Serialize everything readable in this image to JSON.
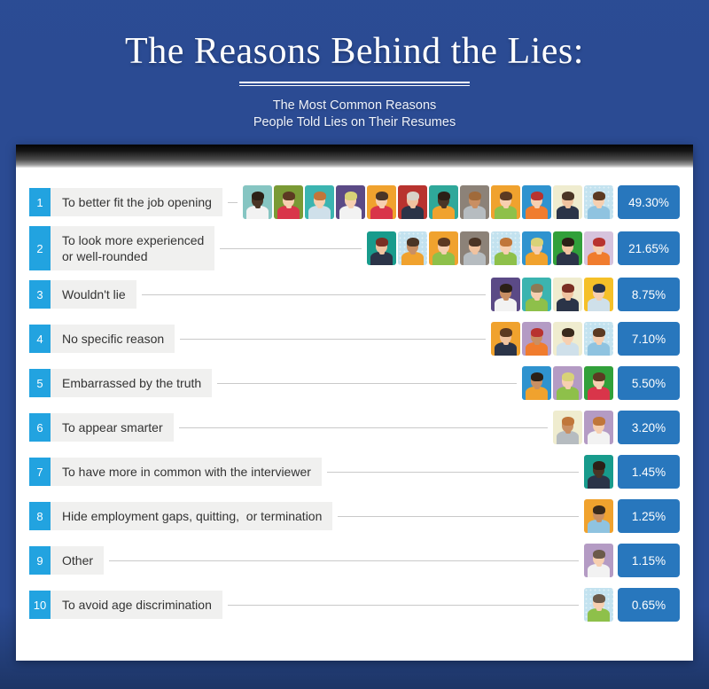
{
  "header": {
    "title": "The Reasons Behind the Lies:",
    "subtitle_line1": "The Most Common Reasons",
    "subtitle_line2": "People Told Lies on Their Resumes"
  },
  "colors": {
    "background": "#2b4b93",
    "card": "#ffffff",
    "rank_badge": "#22a3e0",
    "label_chip": "#f0f0ef",
    "percent_badge": "#2877bd",
    "connector": "#c9c9c9"
  },
  "chart_data": {
    "type": "bar",
    "title": "The Reasons Behind the Lies:",
    "subtitle": "The Most Common Reasons People Told Lies on Their Resumes",
    "xlabel": "",
    "ylabel": "",
    "unit": "%",
    "note": "Pictorial bar chart: each avatar icon represents one unit of the count; bars are right-aligned.",
    "categories": [
      "To better fit the job opening",
      "To look more experienced or well-rounded",
      "Wouldn't lie",
      "No specific reason",
      "Embarrassed by the truth",
      "To appear smarter",
      "To have more in common with the interviewer",
      "Hide employment gaps, quitting,  or termination",
      "Other",
      "To avoid age discrimination"
    ],
    "values": [
      49.3,
      21.65,
      8.75,
      7.1,
      5.5,
      3.2,
      1.45,
      1.25,
      1.15,
      0.65
    ],
    "value_labels": [
      "49.30%",
      "21.65%",
      "8.75%",
      "7.10%",
      "5.50%",
      "3.20%",
      "1.45%",
      "1.25%",
      "1.15%",
      "0.65%"
    ],
    "icon_counts": [
      13,
      8,
      4,
      4,
      3,
      2,
      1,
      1,
      1,
      1
    ],
    "ranks": [
      1,
      2,
      3,
      4,
      5,
      6,
      7,
      8,
      9,
      10
    ]
  },
  "rows": [
    {
      "rank": "1",
      "label": "To better fit the job opening",
      "percent": "49.30%",
      "avatars": [
        {
          "bg": "#86c5c2",
          "hair": "#2b2016",
          "skin": "#4a3526",
          "shirt": "#f2f2f2",
          "dots": false
        },
        {
          "bg": "#7a9a35",
          "hair": "#5c3a22",
          "skin": "#f6cfb0",
          "shirt": "#d9354a",
          "dots": false
        },
        {
          "bg": "#3bb4b0",
          "hair": "#c0763a",
          "skin": "#f6cfb0",
          "shirt": "#cfe0ea",
          "dots": false
        },
        {
          "bg": "#5b4a86",
          "hair": "#d8d277",
          "skin": "#f6cfb0",
          "shirt": "#f2f2f2",
          "dots": false
        },
        {
          "bg": "#f0a22e",
          "hair": "#4a3526",
          "skin": "#f6cfb0",
          "shirt": "#d9354a",
          "dots": false
        },
        {
          "bg": "#b8332f",
          "hair": "#d8d2c8",
          "skin": "#f0c3a0",
          "shirt": "#2b3448",
          "dots": false
        },
        {
          "bg": "#2fa89a",
          "hair": "#2b2016",
          "skin": "#4a3526",
          "shirt": "#f0a22e",
          "dots": false
        },
        {
          "bg": "#8c8278",
          "hair": "#a06a3a",
          "skin": "#c98f63",
          "shirt": "#b6bcc0",
          "dots": false
        },
        {
          "bg": "#f0a22e",
          "hair": "#5c3a22",
          "skin": "#f6cfb0",
          "shirt": "#8ec04a",
          "dots": false
        },
        {
          "bg": "#2f93cf",
          "hair": "#b8332f",
          "skin": "#f6cfb0",
          "shirt": "#f07c2e",
          "dots": false
        },
        {
          "bg": "#efeccf",
          "hair": "#4a3526",
          "skin": "#f0c3a0",
          "shirt": "#2b3448",
          "dots": false
        },
        {
          "bg": "#c3e2ef",
          "hair": "#5c3a22",
          "skin": "#f6cfb0",
          "shirt": "#8fc3e0",
          "dots": true
        }
      ]
    },
    {
      "rank": "2",
      "label": "To look more experienced\nor well-rounded",
      "percent": "21.65%",
      "avatars": [
        {
          "bg": "#189b8c",
          "hair": "#7a2f24",
          "skin": "#f0c3a0",
          "shirt": "#2b3448",
          "dots": false
        },
        {
          "bg": "#c3e2ef",
          "hair": "#4a3526",
          "skin": "#c98f63",
          "shirt": "#f0a22e",
          "dots": true
        },
        {
          "bg": "#f0a22e",
          "hair": "#5c3a22",
          "skin": "#f6cfb0",
          "shirt": "#8ec04a",
          "dots": false
        },
        {
          "bg": "#8c8278",
          "hair": "#4a3526",
          "skin": "#f0c3a0",
          "shirt": "#b6bcc0",
          "dots": false
        },
        {
          "bg": "#c3e2ef",
          "hair": "#c0763a",
          "skin": "#f6cfb0",
          "shirt": "#8ec04a",
          "dots": true
        },
        {
          "bg": "#2f93cf",
          "hair": "#d8d277",
          "skin": "#f6cfb0",
          "shirt": "#f0a22e",
          "dots": false
        },
        {
          "bg": "#31a03a",
          "hair": "#2b2016",
          "skin": "#f0c3a0",
          "shirt": "#2b3448",
          "dots": false
        },
        {
          "bg": "#d6c3dd",
          "hair": "#b8332f",
          "skin": "#f6cfb0",
          "shirt": "#f07c2e",
          "dots": false
        }
      ]
    },
    {
      "rank": "3",
      "label": "Wouldn't lie",
      "percent": "8.75%",
      "avatars": [
        {
          "bg": "#5b4a86",
          "hair": "#2b2016",
          "skin": "#c98f63",
          "shirt": "#f2f2f2",
          "dots": false
        },
        {
          "bg": "#3bb4b0",
          "hair": "#8c7a56",
          "skin": "#f6cfb0",
          "shirt": "#8ec04a",
          "dots": false
        },
        {
          "bg": "#efeccf",
          "hair": "#7a2f24",
          "skin": "#f0c3a0",
          "shirt": "#2b3448",
          "dots": false
        },
        {
          "bg": "#f5c028",
          "hair": "#2b3448",
          "skin": "#f6cfb0",
          "shirt": "#cfe0ea",
          "dots": false
        }
      ]
    },
    {
      "rank": "4",
      "label": "No specific reason",
      "percent": "7.10%",
      "avatars": [
        {
          "bg": "#f0a22e",
          "hair": "#5c3a22",
          "skin": "#f0c3a0",
          "shirt": "#2b3448",
          "dots": false
        },
        {
          "bg": "#b49bc4",
          "hair": "#b8332f",
          "skin": "#c98f63",
          "shirt": "#f07c2e",
          "dots": false
        },
        {
          "bg": "#efeccf",
          "hair": "#3a2a1c",
          "skin": "#f6cfb0",
          "shirt": "#cfe0ea",
          "dots": false
        },
        {
          "bg": "#c3e2ef",
          "hair": "#5c3a22",
          "skin": "#f6cfb0",
          "shirt": "#8fc3e0",
          "dots": true
        }
      ]
    },
    {
      "rank": "5",
      "label": "Embarrassed by the truth",
      "percent": "5.50%",
      "avatars": [
        {
          "bg": "#2f93cf",
          "hair": "#2b2016",
          "skin": "#c98f63",
          "shirt": "#f0a22e",
          "dots": false
        },
        {
          "bg": "#b49bc4",
          "hair": "#d8d277",
          "skin": "#f6cfb0",
          "shirt": "#8ec04a",
          "dots": false
        },
        {
          "bg": "#31a03a",
          "hair": "#5c3a22",
          "skin": "#f6cfb0",
          "shirt": "#d9354a",
          "dots": false
        }
      ]
    },
    {
      "rank": "6",
      "label": "To appear smarter",
      "percent": "3.20%",
      "avatars": [
        {
          "bg": "#efeccf",
          "hair": "#c0763a",
          "skin": "#c98f63",
          "shirt": "#b6bcc0",
          "dots": false
        },
        {
          "bg": "#b49bc4",
          "hair": "#c0763a",
          "skin": "#f6cfb0",
          "shirt": "#f2f2f2",
          "dots": false
        }
      ]
    },
    {
      "rank": "7",
      "label": "To have more in common with the interviewer",
      "percent": "1.45%",
      "avatars": [
        {
          "bg": "#189b8c",
          "hair": "#2b2016",
          "skin": "#4a3526",
          "shirt": "#2b3448",
          "dots": false
        }
      ]
    },
    {
      "rank": "8",
      "label": "Hide employment gaps, quitting,  or termination",
      "percent": "1.25%",
      "avatars": [
        {
          "bg": "#f0a22e",
          "hair": "#3a2a1c",
          "skin": "#c98f63",
          "shirt": "#8fc3e0",
          "dots": false
        }
      ]
    },
    {
      "rank": "9",
      "label": "Other",
      "percent": "1.15%",
      "avatars": [
        {
          "bg": "#b49bc4",
          "hair": "#6b5a4a",
          "skin": "#f6cfb0",
          "shirt": "#f2f2f2",
          "dots": false
        }
      ]
    },
    {
      "rank": "10",
      "label": "To avoid age discrimination",
      "percent": "0.65%",
      "avatars": [
        {
          "bg": "#c3e2ef",
          "hair": "#6b5a4a",
          "skin": "#f6cfb0",
          "shirt": "#8ec04a",
          "dots": true
        }
      ]
    }
  ]
}
